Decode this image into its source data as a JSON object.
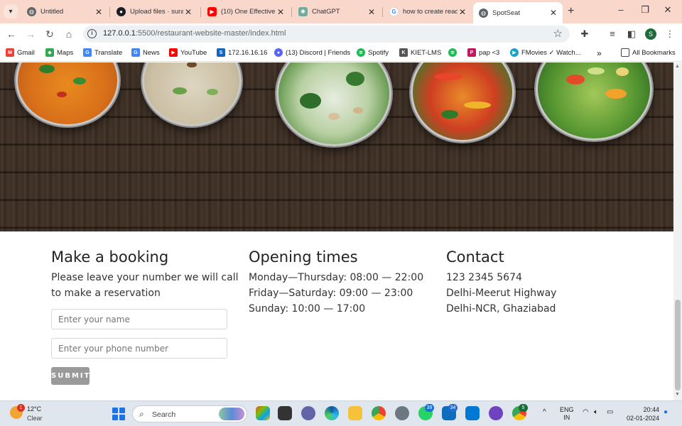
{
  "tabs": [
    {
      "title": "Untitled",
      "icon": "globe-icon",
      "active": false
    },
    {
      "title": "Upload files · suraj",
      "icon": "github-icon",
      "active": false
    },
    {
      "title": "(10) One Effective",
      "icon": "youtube-icon",
      "active": false
    },
    {
      "title": "ChatGPT",
      "icon": "chatgpt-icon",
      "active": false
    },
    {
      "title": "how to create read",
      "icon": "google-icon",
      "active": false
    },
    {
      "title": "SpotSeat",
      "icon": "globe-icon",
      "active": true
    }
  ],
  "address": {
    "host": "127.0.0.1",
    "path": ":5500/restaurant-website-master/index.html"
  },
  "profile_initial": "S",
  "bookmarks": [
    {
      "label": "Gmail",
      "icon": "gmail-icon",
      "color": "#ea4335"
    },
    {
      "label": "Maps",
      "icon": "maps-icon",
      "color": "#34a853"
    },
    {
      "label": "Translate",
      "icon": "translate-icon",
      "color": "#4285f4"
    },
    {
      "label": "News",
      "icon": "news-icon",
      "color": "#4285f4"
    },
    {
      "label": "YouTube",
      "icon": "youtube-icon",
      "color": "#ff0000"
    },
    {
      "label": "172.16.16.16",
      "icon": "site-icon",
      "color": "#1565c0"
    },
    {
      "label": "(13) Discord | Friends",
      "icon": "discord-icon",
      "color": "#5865f2"
    },
    {
      "label": "Spotify",
      "icon": "spotify-icon",
      "color": "#1db954"
    },
    {
      "label": "KIET-LMS",
      "icon": "lms-icon",
      "color": "#555555"
    },
    {
      "label": "",
      "icon": "spotify-icon",
      "color": "#1db954"
    },
    {
      "label": "pap <3",
      "icon": "pap-icon",
      "color": "#c2185b"
    },
    {
      "label": "FMovies ✓ Watch...",
      "icon": "fmovies-icon",
      "color": "#1aa3c8"
    }
  ],
  "bookmarks_more": "»",
  "all_bookmarks": "All Bookmarks",
  "booking": {
    "title": "Make a booking",
    "description_line1": "Please leave your number we will call",
    "description_line2": "to make a reservation",
    "name_placeholder": "Enter your name",
    "phone_placeholder": "Enter your phone number",
    "submit_label": "SUBMIT"
  },
  "opening": {
    "title": "Opening times",
    "lines": [
      "Monday—Thursday: 08:00 — 22:00",
      "Friday—Saturday: 09:00 — 23:00",
      "Sunday: 10:00 — 17:00"
    ]
  },
  "contact": {
    "title": "Contact",
    "lines": [
      "123 2345 5674",
      "Delhi-Meerut Highway",
      "Delhi-NCR, Ghaziabad"
    ]
  },
  "taskbar": {
    "weather_temp": "12°C",
    "weather_condition": "Clear",
    "weather_badge": "1",
    "search_label": "Search",
    "whatsapp_badge": "39",
    "outlook_badge": "34",
    "chrome_badge": "5",
    "lang_line1": "ENG",
    "lang_line2": "IN",
    "time": "20:44",
    "date": "02-01-2024"
  }
}
